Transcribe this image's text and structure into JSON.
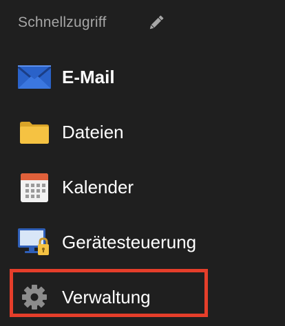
{
  "header": {
    "title": "Schnellzugriff",
    "edit_icon": "pencil-icon"
  },
  "items": [
    {
      "label": "E-Mail",
      "icon": "envelope-icon",
      "bold": true
    },
    {
      "label": "Dateien",
      "icon": "folder-icon",
      "bold": false
    },
    {
      "label": "Kalender",
      "icon": "calendar-icon",
      "bold": false
    },
    {
      "label": "Gerätesteuerung",
      "icon": "monitor-lock-icon",
      "bold": false
    },
    {
      "label": "Verwaltung",
      "icon": "gear-icon",
      "bold": false,
      "highlighted": true
    }
  ],
  "colors": {
    "background": "#1f1f1f",
    "header_text": "#a6a6a6",
    "highlight_border": "#e53e2a",
    "folder": "#f5c242",
    "envelope": "#2a62c9",
    "calendar_header": "#e0603a"
  }
}
